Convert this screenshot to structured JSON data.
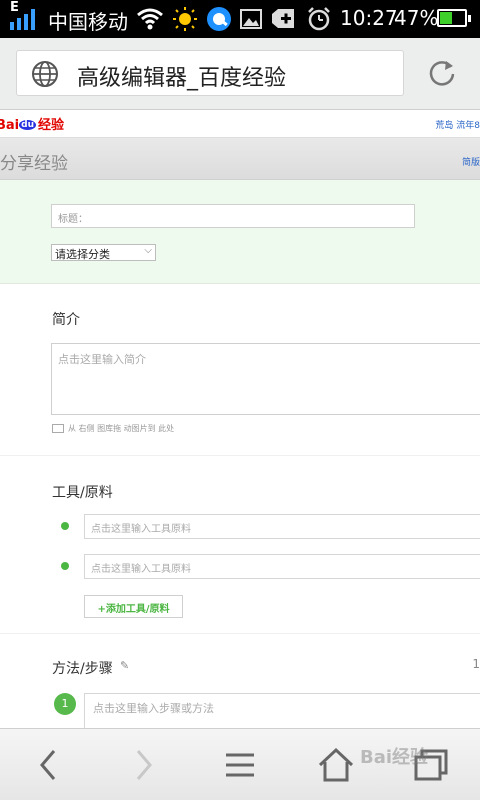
{
  "status_bar": {
    "indicator": "E",
    "carrier": "中国移动",
    "time": "10:27",
    "battery_percent": "47%",
    "battery_level": 0.47
  },
  "browser": {
    "page_title": "高级编辑器_百度经验"
  },
  "site": {
    "logo_bai": "Bai",
    "logo_du": "du",
    "logo_jingyan": "经验",
    "top_right_links": "荒岛 流年8",
    "section_header": "分享经验",
    "section_header_right": "简版"
  },
  "form": {
    "title_placeholder": "标题：",
    "category_select": "请选择分类",
    "intro_label": "简介",
    "intro_placeholder": "点击这里输入简介",
    "upload_hint": "从 右侧 图库拖 动图片到 此处",
    "tools_label": "工具/原料",
    "tool_placeholders": [
      "点击这里输入工具原料",
      "点击这里输入工具原料"
    ],
    "add_tool_button": "+添加工具/原料",
    "steps_label": "方法/步骤",
    "steps_right_mark": "1",
    "step_number": "1",
    "step_placeholder": "点击这里输入步骤或方法"
  },
  "bottom_nav": {
    "watermark": "Bai经验"
  },
  "colors": {
    "accent_green": "#4cb642",
    "baidu_red": "#e10601",
    "baidu_blue": "#2932e1",
    "link_blue": "#2b66c8"
  }
}
